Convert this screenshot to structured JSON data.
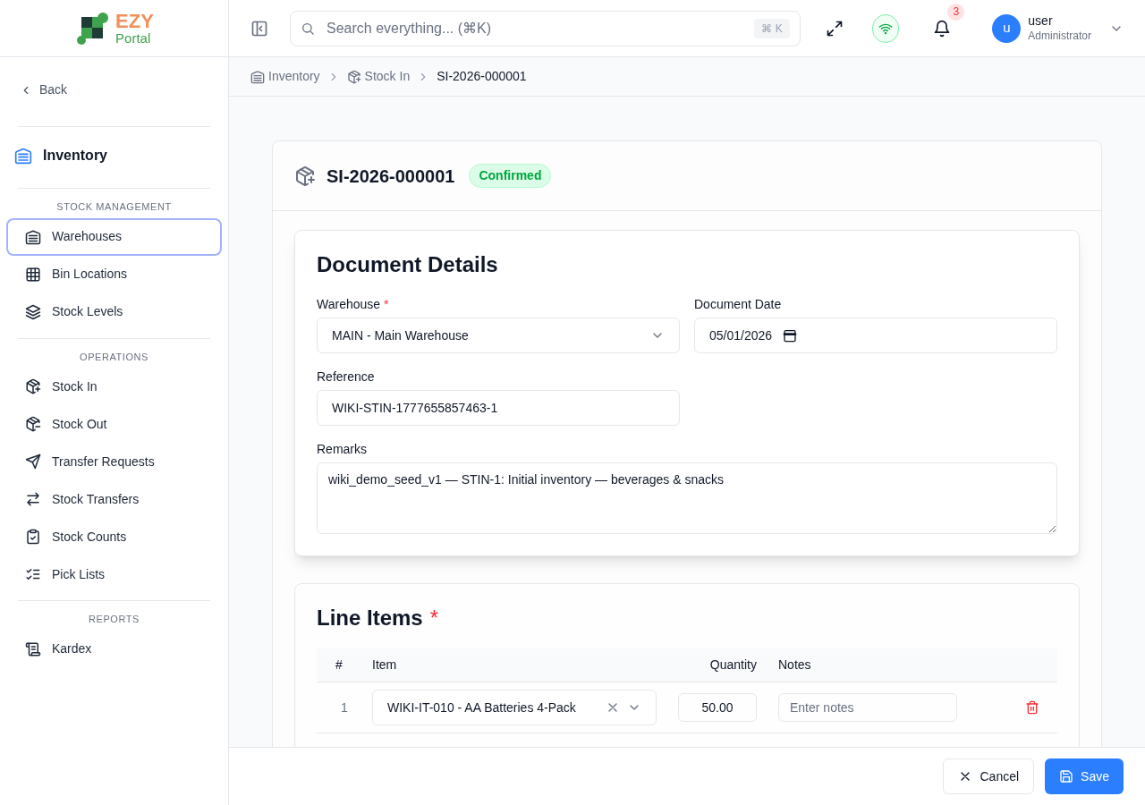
{
  "logo": {
    "line1": "EZY",
    "line2": "Portal"
  },
  "search": {
    "placeholder": "Search everything... (⌘K)",
    "shortcut": "⌘ K"
  },
  "notifications": {
    "count": "3"
  },
  "user": {
    "initial": "u",
    "name": "user",
    "role": "Administrator"
  },
  "breadcrumbs": [
    "Inventory",
    "Stock In",
    "SI-2026-000001"
  ],
  "sidebar": {
    "back": "Back",
    "module": "Inventory",
    "sections": [
      {
        "title": "STOCK MANAGEMENT",
        "items": [
          {
            "label": "Warehouses",
            "selected": true
          },
          {
            "label": "Bin Locations",
            "selected": false
          },
          {
            "label": "Stock Levels",
            "selected": false
          }
        ]
      },
      {
        "title": "OPERATIONS",
        "items": [
          {
            "label": "Stock In",
            "selected": false
          },
          {
            "label": "Stock Out",
            "selected": false
          },
          {
            "label": "Transfer Requests",
            "selected": false
          },
          {
            "label": "Stock Transfers",
            "selected": false
          },
          {
            "label": "Stock Counts",
            "selected": false
          },
          {
            "label": "Pick Lists",
            "selected": false
          }
        ]
      },
      {
        "title": "REPORTS",
        "items": [
          {
            "label": "Kardex",
            "selected": false
          }
        ]
      }
    ]
  },
  "document": {
    "number": "SI-2026-000001",
    "status": "Confirmed",
    "details": {
      "title": "Document Details",
      "warehouse": {
        "label": "Warehouse",
        "required_mark": "*",
        "value": "MAIN - Main Warehouse"
      },
      "date": {
        "label": "Document Date",
        "value": "05/01/2026"
      },
      "reference": {
        "label": "Reference",
        "value": "WIKI-STIN-1777655857463-1"
      },
      "remarks": {
        "label": "Remarks",
        "value": "wiki_demo_seed_v1 — STIN-1: Initial inventory — beverages & snacks"
      }
    },
    "line_items": {
      "title": "Line Items",
      "required_mark": "*",
      "columns": [
        "#",
        "Item",
        "Quantity",
        "Notes"
      ],
      "rows": [
        {
          "number": "1",
          "item": "WIKI-IT-010 - AA Batteries 4-Pack",
          "quantity": "50.00",
          "notes_placeholder": "Enter notes"
        }
      ]
    }
  },
  "footer": {
    "buttons": [
      "Cancel",
      "Save"
    ]
  }
}
